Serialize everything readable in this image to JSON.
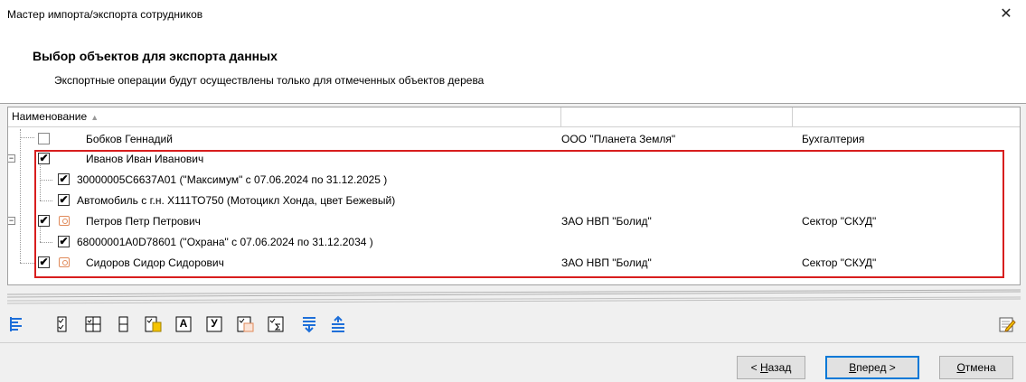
{
  "window": {
    "title": "Мастер импорта/экспорта сотрудников",
    "close_symbol": "✕"
  },
  "header": {
    "heading": "Выбор объектов для экспорта данных",
    "subheading": "Экспортные операции будут осуществлены только для отмеченных объектов дерева"
  },
  "tree": {
    "columns": [
      {
        "label": "Наименование",
        "sort_indicator": "▲"
      },
      {
        "label": ""
      },
      {
        "label": ""
      }
    ],
    "rows": [
      {
        "name": "Бобков Геннадий",
        "org": "ООО \"Планета Земля\"",
        "dept": "Бухгалтерия",
        "checked": false,
        "expander": "",
        "icon": ""
      },
      {
        "name": "Иванов Иван Иванович",
        "org": "",
        "dept": "",
        "checked": true,
        "expander": "−",
        "icon": ""
      },
      {
        "name": "30000005C6637A01 (\"Максимум\" с 07.06.2024  по 31.12.2025 )",
        "org": "",
        "dept": "",
        "checked": true,
        "expander": "",
        "icon": ""
      },
      {
        "name": "Автомобиль с г.н. Х111ТО750 (Мотоцикл Хонда, цвет Бежевый)",
        "org": "",
        "dept": "",
        "checked": true,
        "expander": "",
        "icon": ""
      },
      {
        "name": "Петров Петр Петрович",
        "org": "ЗАО НВП \"Болид\"",
        "dept": "Сектор \"СКУД\"",
        "checked": true,
        "expander": "−",
        "icon": "person-icon"
      },
      {
        "name": "68000001A0D78601 (\"Охрана\" с 07.06.2024  по 31.12.2034 )",
        "org": "",
        "dept": "",
        "checked": true,
        "expander": "",
        "icon": ""
      },
      {
        "name": "Сидоров Сидор Сидорович",
        "org": "ЗАО НВП \"Болид\"",
        "dept": "Сектор \"СКУД\"",
        "checked": true,
        "expander": "",
        "icon": "person-icon"
      }
    ],
    "check_mark": "✔"
  },
  "toolbar": {
    "letter_a": "А",
    "letter_u": "У"
  },
  "buttons": {
    "back": {
      "prefix": "< ",
      "accel": "Н",
      "rest": "азад"
    },
    "next": {
      "accel": "В",
      "rest": "перед >"
    },
    "cancel": {
      "accel": "О",
      "rest": "тмена"
    }
  },
  "colors": {
    "highlight": "#d81e1e",
    "accent_blue": "#1e6fd9",
    "icon_orange": "#e08a5a"
  }
}
